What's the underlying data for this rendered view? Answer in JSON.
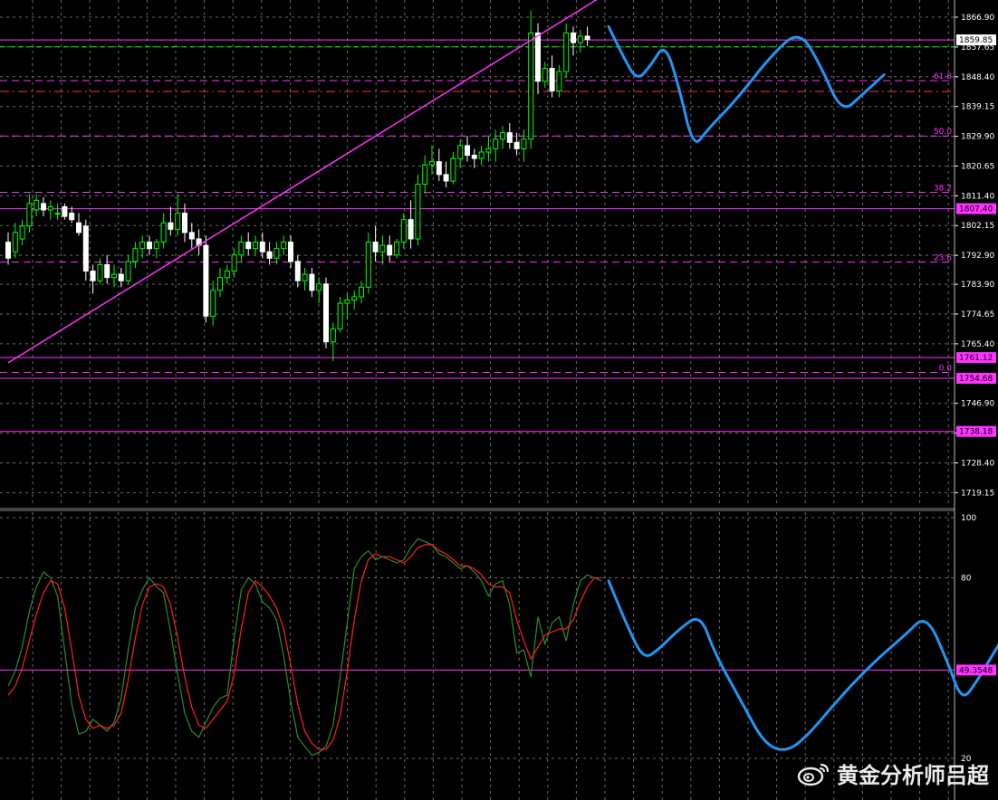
{
  "watermark": {
    "text": "黄金分析师吕超",
    "logo": "weibo-logo-icon"
  },
  "colors": {
    "background": "#000000",
    "grid": "#6b6b6b",
    "bull": "#00ff00",
    "bull_body": "#000000",
    "bear": "#ffffff",
    "level_line": "#ff33ff",
    "fib_line": "#ff33ff",
    "dashed_green": "#00ff00",
    "dashed_red": "#ff3333",
    "trendline": "#ff33ff",
    "forecast": "#2196f3",
    "stoch_main": "#2e8b2e",
    "stoch_signal": "#ff2020",
    "axis_text": "#ffffff"
  },
  "chart_data": [
    {
      "type": "candlestick",
      "title": "",
      "y_ticks": [
        "1866.90",
        "1857.65",
        "1848.40",
        "1839.15",
        "1829.90",
        "1820.65",
        "1811.40",
        "1802.15",
        "1792.90",
        "1783.90",
        "1774.65",
        "1765.40",
        "1746.90",
        "1737.65",
        "1728.40",
        "1719.15"
      ],
      "ylim": [
        1717,
        1870
      ],
      "price_tags": [
        "1859.85",
        "1807.40",
        "1761.12",
        "1754.68",
        "1738.18"
      ],
      "fib_levels": [
        {
          "label": "61.8",
          "value": 1847.2
        },
        {
          "label": "50.0",
          "value": 1830.0
        },
        {
          "label": "38.2",
          "value": 1812.5
        },
        {
          "label": "23.6",
          "value": 1790.8
        },
        {
          "label": "0.0",
          "value": 1756.5
        }
      ],
      "horizontal_lines": [
        1859.85,
        1807.4,
        1761.12,
        1754.68,
        1738.18
      ],
      "dashed_green_line": 1857.7,
      "dashed_red_line": 1843.8,
      "trendline": {
        "from": [
          0,
          1759.5
        ],
        "to": [
          86,
          1876
        ]
      },
      "candles_ohlc": [
        [
          1797,
          1800,
          1790,
          1792
        ],
        [
          1794,
          1803,
          1792,
          1800
        ],
        [
          1798,
          1804,
          1796,
          1802
        ],
        [
          1802,
          1812,
          1800,
          1809
        ],
        [
          1807,
          1812,
          1805,
          1810
        ],
        [
          1809,
          1811,
          1805,
          1807
        ],
        [
          1807,
          1810,
          1804,
          1808
        ],
        [
          1806,
          1809,
          1804,
          1806
        ],
        [
          1808,
          1809,
          1804,
          1805
        ],
        [
          1806,
          1808,
          1803,
          1804
        ],
        [
          1803,
          1806,
          1799,
          1800
        ],
        [
          1802,
          1804,
          1785,
          1788
        ],
        [
          1788,
          1790,
          1781,
          1785
        ],
        [
          1785,
          1792,
          1784,
          1790
        ],
        [
          1790,
          1793,
          1784,
          1786
        ],
        [
          1786,
          1790,
          1783,
          1787
        ],
        [
          1787,
          1789,
          1783,
          1785
        ],
        [
          1785,
          1793,
          1784,
          1791
        ],
        [
          1791,
          1797,
          1789,
          1795
        ],
        [
          1795,
          1799,
          1792,
          1797
        ],
        [
          1797,
          1799,
          1793,
          1795
        ],
        [
          1795,
          1798,
          1792,
          1797
        ],
        [
          1797,
          1806,
          1795,
          1803
        ],
        [
          1803,
          1808,
          1799,
          1801
        ],
        [
          1801,
          1812,
          1799,
          1806
        ],
        [
          1806,
          1809,
          1797,
          1800
        ],
        [
          1800,
          1803,
          1795,
          1798
        ],
        [
          1798,
          1801,
          1793,
          1796
        ],
        [
          1796,
          1799,
          1772,
          1774
        ],
        [
          1774,
          1785,
          1771,
          1782
        ],
        [
          1782,
          1789,
          1780,
          1786
        ],
        [
          1786,
          1790,
          1784,
          1788
        ],
        [
          1788,
          1795,
          1786,
          1793
        ],
        [
          1793,
          1799,
          1791,
          1797
        ],
        [
          1797,
          1800,
          1793,
          1795
        ],
        [
          1795,
          1799,
          1793,
          1797
        ],
        [
          1797,
          1800,
          1792,
          1794
        ],
        [
          1794,
          1797,
          1790,
          1792
        ],
        [
          1792,
          1797,
          1790,
          1795
        ],
        [
          1795,
          1799,
          1793,
          1797
        ],
        [
          1797,
          1799,
          1789,
          1791
        ],
        [
          1791,
          1793,
          1783,
          1785
        ],
        [
          1785,
          1789,
          1782,
          1787
        ],
        [
          1787,
          1789,
          1780,
          1782
        ],
        [
          1782,
          1786,
          1778,
          1784
        ],
        [
          1784,
          1786,
          1764,
          1766
        ],
        [
          1766,
          1772,
          1760,
          1770
        ],
        [
          1770,
          1780,
          1769,
          1778
        ],
        [
          1778,
          1781,
          1773,
          1779
        ],
        [
          1779,
          1782,
          1776,
          1780
        ],
        [
          1780,
          1785,
          1778,
          1783
        ],
        [
          1783,
          1800,
          1781,
          1797
        ],
        [
          1797,
          1802,
          1791,
          1794
        ],
        [
          1794,
          1799,
          1790,
          1796
        ],
        [
          1796,
          1799,
          1791,
          1793
        ],
        [
          1793,
          1798,
          1792,
          1797
        ],
        [
          1797,
          1806,
          1795,
          1804
        ],
        [
          1804,
          1810,
          1795,
          1798
        ],
        [
          1798,
          1818,
          1796,
          1815
        ],
        [
          1815,
          1824,
          1812,
          1821
        ],
        [
          1821,
          1827,
          1818,
          1822
        ],
        [
          1822,
          1826,
          1816,
          1818
        ],
        [
          1818,
          1822,
          1814,
          1816
        ],
        [
          1816,
          1825,
          1815,
          1823
        ],
        [
          1823,
          1829,
          1820,
          1827
        ],
        [
          1827,
          1830,
          1822,
          1824
        ],
        [
          1824,
          1826,
          1820,
          1823
        ],
        [
          1823,
          1827,
          1821,
          1825
        ],
        [
          1825,
          1830,
          1822,
          1826
        ],
        [
          1826,
          1832,
          1822,
          1829
        ],
        [
          1829,
          1833,
          1826,
          1831
        ],
        [
          1831,
          1834,
          1826,
          1828
        ],
        [
          1828,
          1831,
          1824,
          1826
        ],
        [
          1826,
          1832,
          1822,
          1829
        ],
        [
          1829,
          1869,
          1826,
          1862
        ],
        [
          1862,
          1865,
          1843,
          1847
        ],
        [
          1847,
          1853,
          1845,
          1851
        ],
        [
          1851,
          1855,
          1842,
          1844
        ],
        [
          1844,
          1852,
          1842,
          1850
        ],
        [
          1850,
          1865,
          1848,
          1862
        ],
        [
          1862,
          1864,
          1855,
          1859
        ],
        [
          1859,
          1863,
          1856,
          1861
        ],
        [
          1861,
          1864,
          1858,
          1860
        ]
      ],
      "forecast_path": [
        [
          85,
          1864
        ],
        [
          87,
          1855
        ],
        [
          89,
          1847
        ],
        [
          91,
          1852
        ],
        [
          93,
          1859
        ],
        [
          95,
          1845
        ],
        [
          97,
          1826
        ],
        [
          99,
          1832
        ],
        [
          103,
          1841
        ],
        [
          108,
          1855
        ],
        [
          112,
          1863
        ],
        [
          115,
          1852
        ],
        [
          118,
          1837
        ],
        [
          121,
          1843
        ],
        [
          124,
          1849
        ]
      ]
    },
    {
      "type": "line",
      "title": "",
      "y_ticks": [
        "100",
        "80",
        "49.3548",
        "20"
      ],
      "ylim": [
        20,
        100
      ],
      "level_line": 49.3548,
      "series": [
        {
          "role": "main",
          "values": [
            44,
            49,
            57,
            69,
            77,
            82,
            80,
            74,
            56,
            38,
            28,
            29,
            33,
            31,
            29,
            32,
            40,
            56,
            70,
            76,
            80,
            77,
            75,
            62,
            48,
            35,
            29,
            27,
            32,
            37,
            40,
            41,
            60,
            76,
            80,
            78,
            72,
            70,
            66,
            54,
            39,
            27,
            24,
            21,
            22,
            24,
            31,
            47,
            65,
            83,
            87,
            89,
            86,
            87,
            86,
            85,
            86,
            90,
            93,
            92,
            91,
            88,
            87,
            85,
            83,
            84,
            82,
            79,
            74,
            78,
            79,
            71,
            55,
            56,
            47,
            67,
            58,
            65,
            67,
            59,
            71,
            79,
            81,
            80,
            79
          ]
        },
        {
          "role": "signal",
          "values": [
            41,
            44,
            50,
            59,
            68,
            75,
            79,
            78,
            70,
            56,
            41,
            33,
            30,
            31,
            30,
            31,
            35,
            46,
            60,
            71,
            77,
            78,
            77,
            71,
            60,
            47,
            37,
            31,
            30,
            33,
            36,
            39,
            48,
            63,
            75,
            79,
            77,
            74,
            70,
            63,
            51,
            38,
            29,
            25,
            23,
            23,
            26,
            34,
            49,
            66,
            79,
            86,
            88,
            87,
            87,
            86,
            85,
            87,
            90,
            91,
            91,
            89,
            88,
            86,
            84,
            84,
            83,
            81,
            78,
            77,
            77,
            75,
            66,
            59,
            53,
            57,
            61,
            62,
            63,
            63,
            66,
            72,
            77,
            80,
            80
          ]
        }
      ],
      "forecast_path": [
        [
          85,
          79
        ],
        [
          88,
          62
        ],
        [
          90,
          53
        ],
        [
          92,
          56
        ],
        [
          95,
          63
        ],
        [
          98,
          68
        ],
        [
          100,
          55
        ],
        [
          104,
          38
        ],
        [
          107,
          25
        ],
        [
          110,
          22
        ],
        [
          113,
          27
        ],
        [
          118,
          41
        ],
        [
          123,
          53
        ],
        [
          127,
          61
        ],
        [
          130,
          68
        ],
        [
          133,
          52
        ],
        [
          135,
          39
        ],
        [
          137,
          45
        ],
        [
          140,
          57
        ],
        [
          142,
          64
        ]
      ]
    }
  ]
}
